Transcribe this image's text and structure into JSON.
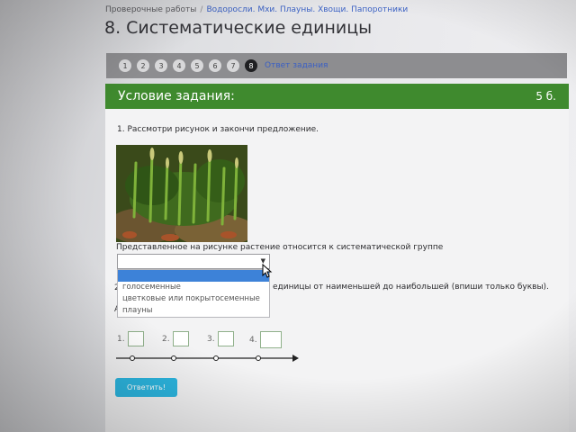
{
  "breadcrumb": {
    "items": [
      "Проверочные работы",
      "Водоросли. Мхи. Плауны. Хвощи. Папоротники"
    ],
    "separator": "/"
  },
  "page_title": "8. Систематические единицы",
  "steps": {
    "items": [
      "1",
      "2",
      "3",
      "4",
      "5",
      "6",
      "7",
      "8"
    ],
    "active_index": 7,
    "link_label": "Ответ задания"
  },
  "task": {
    "header_title": "Условие задания:",
    "score": "5 б.",
    "question1": "1. Рассмотри рисунок и закончи предложение.",
    "sentence": "Представленное на рисунке растение относится к систематической группе",
    "select_value": "",
    "options": [
      "",
      "голосеменные",
      "цветковые или покрытосеменные",
      "плауны"
    ],
    "question2_prefix": "2.",
    "question2_text": "единицы от наименьшей до наибольшей (впиши только буквы).",
    "question2_suffix": "А",
    "slots": [
      "1.",
      "2.",
      "3.",
      "4."
    ],
    "answer_button": "Ответить!"
  },
  "colors": {
    "header_green": "#3f8a2e",
    "button_blue": "#2cb6e0",
    "highlight_blue": "#3d82d8",
    "link_blue": "#3c62c4"
  }
}
